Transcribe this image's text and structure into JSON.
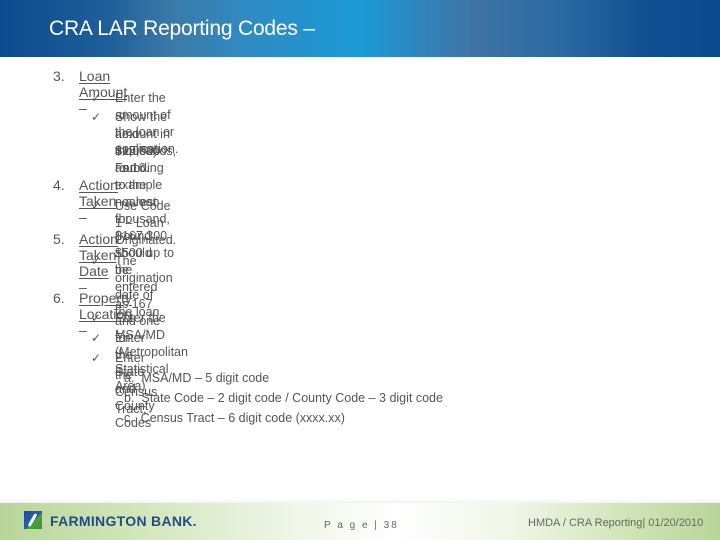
{
  "header": {
    "title": "CRA LAR Reporting Codes –"
  },
  "sections": [
    {
      "number": "3.",
      "heading": "Loan Amount ",
      "suffix": "–",
      "bullets": [
        "Enter the amount of the loan or application.",
        "Show the amount in thousands, rounding to the nearest thousand, (round $500 up to the",
        "next $1,000) For example – a loan for $167,300 should be entered as 167 and one for",
        "$15,500 as 16."
      ]
    },
    {
      "number": "4.",
      "heading": "Action Taken",
      "suffix": " –",
      "bullets": [
        "Use Code 1 – Loan Originated."
      ]
    },
    {
      "number": "5.",
      "heading": "Action Taken Date",
      "suffix": " –",
      "bullets": [
        "The origination date of the loan."
      ]
    },
    {
      "number": "6.",
      "heading": "Property Location ",
      "suffix": "–",
      "bullets": [
        "Enter the MSA/MD (Metropolitan Statistical Area)",
        "Enter the State and County Codes",
        "Enter the Census Tract;"
      ],
      "subitems": [
        "a.  MSA/MD – 5 digit code",
        "b.  State Code – 2 digit code / County Code – 3 digit code",
        "c.  Census Tract – 6 digit code (xxxx.xx)"
      ]
    }
  ],
  "checkmark": "✓",
  "footer": {
    "logo_text": "FARMINGTON BANK.",
    "page_label": "P a g e | 38",
    "right_text": "HMDA / CRA Reporting| 01/20/2010"
  }
}
